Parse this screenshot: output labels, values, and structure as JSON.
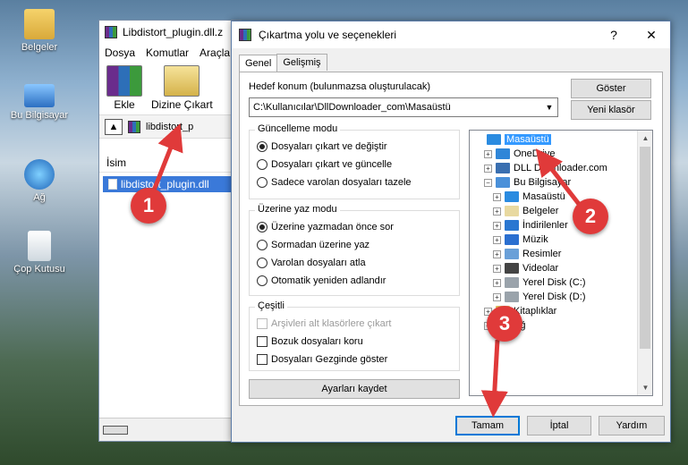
{
  "desktop": {
    "icons": [
      {
        "label": "Belgeler",
        "icon": "folder-icon"
      },
      {
        "label": "Bu Bilgisayar",
        "icon": "computer-icon"
      },
      {
        "label": "Ağ",
        "icon": "network-icon"
      },
      {
        "label": "Çop Kutusu",
        "icon": "recycle-bin-icon"
      }
    ]
  },
  "winrar": {
    "title": "Libdistort_plugin.dll.z",
    "menu": [
      "Dosya",
      "Komutlar",
      "Araçla"
    ],
    "toolbar": {
      "add_label": "Ekle",
      "extract_label": "Dizine Çıkart"
    },
    "address": "libdistort_p",
    "column_name": "İsim",
    "file_name": "libdistort_plugin.dll"
  },
  "dialog": {
    "title": "Çıkartma yolu ve seçenekleri",
    "title_buttons": {
      "help": "?",
      "close": "✕"
    },
    "tabs": [
      "Genel",
      "Gelişmiş"
    ],
    "destination_label": "Hedef konum (bulunmazsa oluşturulacak)",
    "destination_value": "C:\\Kullanıcılar\\DllDownloader_com\\Masaüstü",
    "show_button": "Göster",
    "new_folder_button": "Yeni klasör",
    "update_mode": {
      "title": "Güncelleme modu",
      "options": [
        "Dosyaları çıkart ve değiştir",
        "Dosyaları çıkart ve güncelle",
        "Sadece varolan dosyaları tazele"
      ],
      "selected": 0
    },
    "overwrite_mode": {
      "title": "Üzerine yaz modu",
      "options": [
        "Üzerine yazmadan önce sor",
        "Sormadan üzerine yaz",
        "Varolan dosyaları atla",
        "Otomatik yeniden adlandır"
      ],
      "selected": 0
    },
    "misc": {
      "title": "Çeşitli",
      "options": [
        {
          "label": "Arşivleri alt klasörlere çıkart",
          "checked": false,
          "disabled": true
        },
        {
          "label": "Bozuk dosyaları koru",
          "checked": false,
          "disabled": false
        },
        {
          "label": "Dosyaları Gezginde göster",
          "checked": false,
          "disabled": false
        }
      ]
    },
    "save_settings_button": "Ayarları kaydet",
    "tree": [
      {
        "label": "Masaüstü",
        "level": 0,
        "icon": "desktop-icon",
        "selected": true,
        "expander": ""
      },
      {
        "label": "OneDrive",
        "level": 1,
        "icon": "cloud-icon",
        "expander": "+"
      },
      {
        "label": "DLL Downloader.com",
        "level": 1,
        "icon": "user-icon",
        "expander": "+"
      },
      {
        "label": "Bu Bilgisayar",
        "level": 1,
        "icon": "computer-icon",
        "expander": "−"
      },
      {
        "label": "Masaüstü",
        "level": 2,
        "icon": "desktop-icon",
        "expander": "+"
      },
      {
        "label": "Belgeler",
        "level": 2,
        "icon": "documents-icon",
        "expander": "+"
      },
      {
        "label": "İndirilenler",
        "level": 2,
        "icon": "download-icon",
        "expander": "+"
      },
      {
        "label": "Müzik",
        "level": 2,
        "icon": "music-icon",
        "expander": "+"
      },
      {
        "label": "Resimler",
        "level": 2,
        "icon": "pictures-icon",
        "expander": "+"
      },
      {
        "label": "Videolar",
        "level": 2,
        "icon": "videos-icon",
        "expander": "+"
      },
      {
        "label": "Yerel Disk (C:)",
        "level": 2,
        "icon": "drive-icon",
        "expander": "+"
      },
      {
        "label": "Yerel Disk (D:)",
        "level": 2,
        "icon": "drive-icon",
        "expander": "+"
      },
      {
        "label": "Kitaplıklar",
        "level": 1,
        "icon": "library-icon",
        "expander": "+"
      },
      {
        "label": "Ağ",
        "level": 1,
        "icon": "network-icon",
        "expander": "+"
      }
    ],
    "ok_button": "Tamam",
    "cancel_button": "İptal",
    "help_button": "Yardım"
  },
  "callouts": [
    "1",
    "2",
    "3"
  ],
  "colors": {
    "callout": "#e03a3a",
    "selection": "#3399ff",
    "file_selection": "#3a79d9"
  }
}
